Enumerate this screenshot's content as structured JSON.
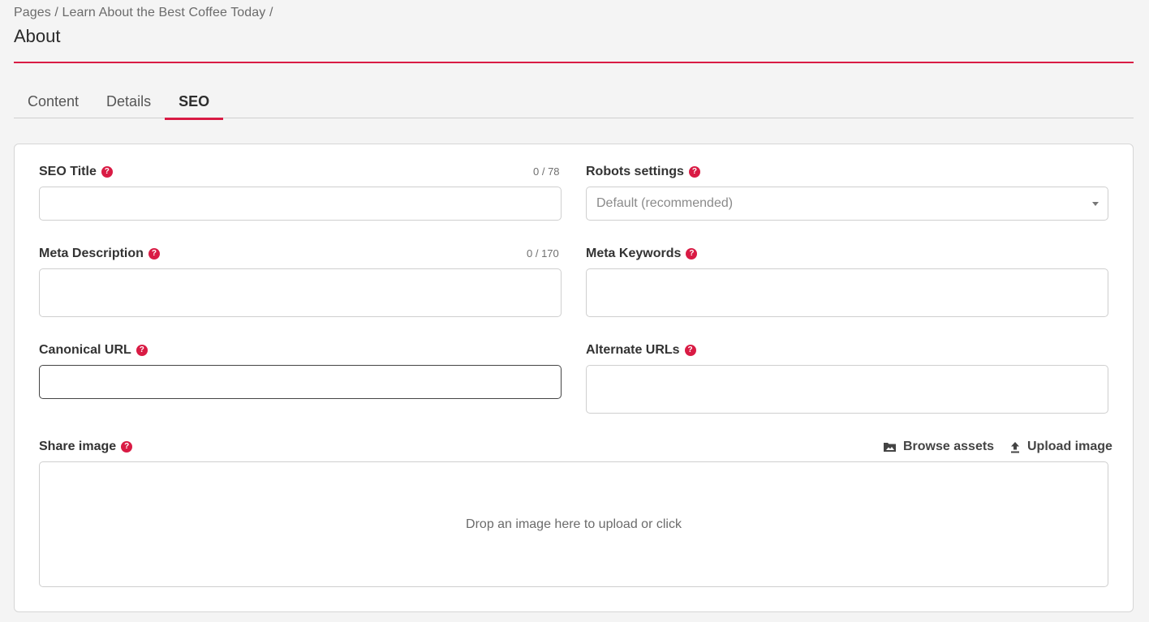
{
  "header": {
    "breadcrumb": "Pages / Learn About the Best Coffee Today /",
    "title": "About"
  },
  "tabs": [
    {
      "label": "Content",
      "active": false
    },
    {
      "label": "Details",
      "active": false
    },
    {
      "label": "SEO",
      "active": true
    }
  ],
  "form": {
    "seo_title": {
      "label": "SEO Title",
      "counter": "0 / 78",
      "value": ""
    },
    "robots": {
      "label": "Robots settings",
      "selected": "Default (recommended)"
    },
    "meta_description": {
      "label": "Meta Description",
      "counter": "0 / 170",
      "value": ""
    },
    "meta_keywords": {
      "label": "Meta Keywords",
      "value": ""
    },
    "canonical_url": {
      "label": "Canonical URL",
      "value": ""
    },
    "alternate_urls": {
      "label": "Alternate URLs",
      "value": ""
    },
    "share_image": {
      "label": "Share image",
      "browse_label": "Browse assets",
      "upload_label": "Upload image",
      "dropzone_text": "Drop an image here to upload or click"
    },
    "help_glyph": "?"
  },
  "colors": {
    "accent": "#d91b44",
    "background": "#f4f4f4",
    "card": "#ffffff"
  },
  "icons": [
    "help-icon",
    "caret-down-icon",
    "image-folder-icon",
    "upload-icon"
  ]
}
